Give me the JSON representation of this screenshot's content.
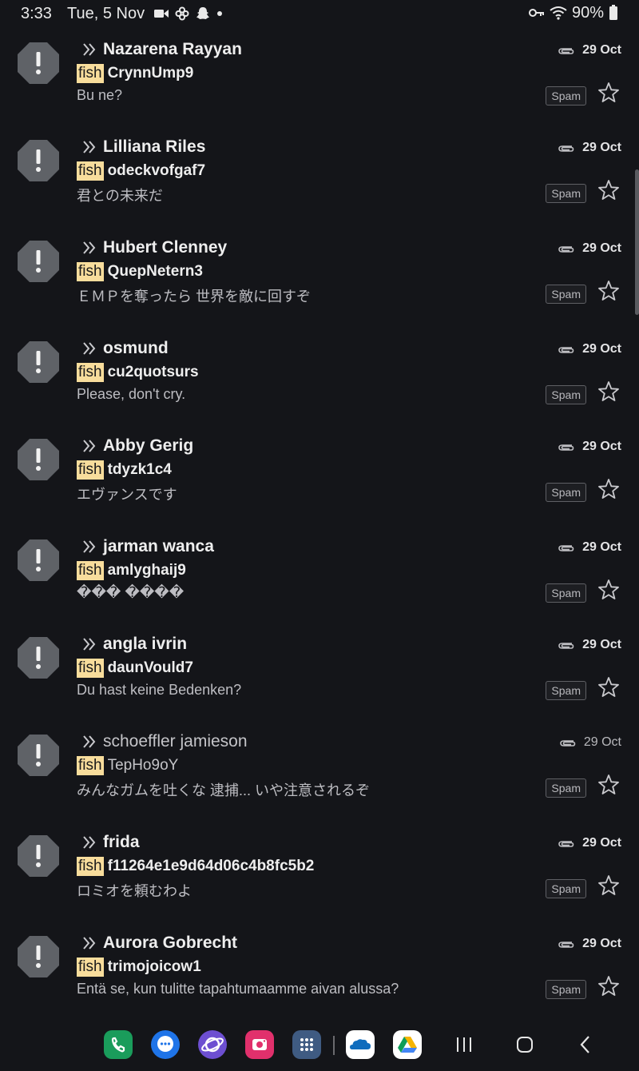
{
  "status_bar": {
    "time": "3:33",
    "date": "Tue, 5 Nov",
    "battery": "90%",
    "left_icons": [
      "video-icon",
      "pinwheel-icon",
      "snapchat-icon",
      "dot-icon"
    ],
    "right_icons": [
      "key-icon",
      "wifi-icon",
      "battery-icon"
    ]
  },
  "colors": {
    "background": "#141519",
    "label_fish": "#f8dd9c",
    "avatar": "#5f6267"
  },
  "emails": [
    {
      "sender": "Nazarena Rayyan",
      "label": "fish",
      "subject": "CrynnUmp9",
      "snippet": "Bu ne?",
      "date": "29 Oct",
      "badge": "Spam",
      "read": false
    },
    {
      "sender": "Lilliana Riles",
      "label": "fish",
      "subject": "odeckvofgaf7",
      "snippet": "君との未来だ",
      "date": "29 Oct",
      "badge": "Spam",
      "read": false
    },
    {
      "sender": "Hubert Clenney",
      "label": "fish",
      "subject": "QuepNetern3",
      "snippet": "ＥＭＰを奪ったら 世界を敵に回すぞ",
      "date": "29 Oct",
      "badge": "Spam",
      "read": false
    },
    {
      "sender": "osmund",
      "label": "fish",
      "subject": "cu2quotsurs",
      "snippet": "Please, don't cry.",
      "date": "29 Oct",
      "badge": "Spam",
      "read": false
    },
    {
      "sender": "Abby Gerig",
      "label": "fish",
      "subject": "tdyzk1c4",
      "snippet": "エヴァンスです",
      "date": "29 Oct",
      "badge": "Spam",
      "read": false
    },
    {
      "sender": "jarman wanca",
      "label": "fish",
      "subject": "amlyghaij9",
      "snippet": "��� ����",
      "date": "29 Oct",
      "badge": "Spam",
      "read": false
    },
    {
      "sender": "angla ivrin",
      "label": "fish",
      "subject": "daunVould7",
      "snippet": "Du hast keine Bedenken?",
      "date": "29 Oct",
      "badge": "Spam",
      "read": false
    },
    {
      "sender": "schoeffler jamieson",
      "label": "fish",
      "subject": "TepHo9oY",
      "snippet": "みんなガムを吐くな 逮捕... いや注意されるぞ",
      "date": "29 Oct",
      "badge": "Spam",
      "read": true
    },
    {
      "sender": "frida",
      "label": "fish",
      "subject": "f11264e1e9d64d06c4b8fc5b2",
      "snippet": "ロミオを頼むわよ",
      "date": "29 Oct",
      "badge": "Spam",
      "read": false
    },
    {
      "sender": "Aurora Gobrecht",
      "label": "fish",
      "subject": "trimojoicow1",
      "snippet": "Entä se, kun tulitte tapahtumaamme aivan alussa?",
      "date": "29 Oct",
      "badge": "Spam",
      "read": false
    }
  ],
  "nav_bar": {
    "apps": [
      {
        "name": "phone",
        "color": "#1a9c5b"
      },
      {
        "name": "messages",
        "color": "#1f74e8"
      },
      {
        "name": "internet",
        "color": "#6d4fd1"
      },
      {
        "name": "camera",
        "color": "#e1306c"
      },
      {
        "name": "apps-drawer",
        "color": "#3f5b82"
      },
      {
        "name": "onedrive",
        "color": "#ffffff"
      },
      {
        "name": "drive",
        "color": "#ffffff"
      }
    ],
    "buttons": [
      "recents",
      "home",
      "back"
    ]
  }
}
